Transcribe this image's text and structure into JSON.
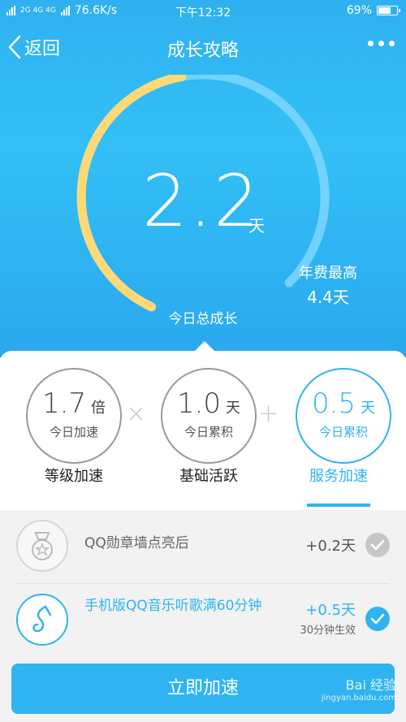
{
  "status_bar": {
    "network_types": "2G 4G 4G",
    "speed": "76.6K/s",
    "time": "下午12:32",
    "battery": "69%",
    "battery_level": 0.69
  },
  "nav": {
    "back_label": "返回",
    "title": "成长攻略"
  },
  "growth": {
    "total_value": "2.2",
    "total_unit": "天",
    "max_label": "年费最高",
    "max_value": "4.4天",
    "today_label": "今日总成长",
    "progress_fraction": 0.5,
    "colors": {
      "progress": "#ffd978",
      "track": "#7fd6ff"
    }
  },
  "components": [
    {
      "value": "1.7",
      "unit": "倍",
      "sub": "今日加速",
      "tab": "等级加速"
    },
    {
      "value": "1.0",
      "unit": "天",
      "sub": "今日累积",
      "tab": "基础活跃"
    },
    {
      "value": "0.5",
      "unit": "天",
      "sub": "今日累积",
      "tab": "服务加速"
    }
  ],
  "operators": {
    "times": "×",
    "plus": "+"
  },
  "tasks": [
    {
      "icon": "medal-icon",
      "text": "QQ勋章墙点亮后",
      "bonus": "+0.2天",
      "sub": "",
      "done": true
    },
    {
      "icon": "music-note-icon",
      "text": "手机版QQ音乐听歌满60分钟",
      "bonus": "+0.5天",
      "sub": "30分钟生效",
      "done": true
    }
  ],
  "cta_label": "立即加速",
  "watermark": {
    "text": "Bai 经验",
    "sub": "jingyan.baidu.com"
  },
  "accent_color": "#2fb4f1"
}
